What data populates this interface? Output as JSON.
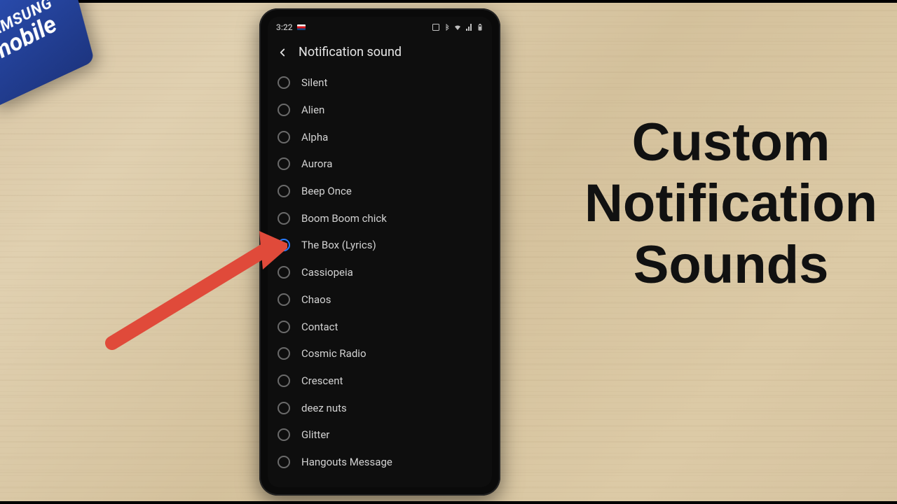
{
  "cube": {
    "line1": "SAMSUNG",
    "line2": "mobile"
  },
  "status": {
    "time": "3:22"
  },
  "header": {
    "title": "Notification sound"
  },
  "sounds": [
    {
      "label": "Silent",
      "selected": false
    },
    {
      "label": "Alien",
      "selected": false
    },
    {
      "label": "Alpha",
      "selected": false
    },
    {
      "label": "Aurora",
      "selected": false
    },
    {
      "label": "Beep Once",
      "selected": false
    },
    {
      "label": "Boom Boom chick",
      "selected": false
    },
    {
      "label": "The Box (Lyrics)",
      "selected": true
    },
    {
      "label": "Cassiopeia",
      "selected": false
    },
    {
      "label": "Chaos",
      "selected": false
    },
    {
      "label": "Contact",
      "selected": false
    },
    {
      "label": "Cosmic Radio",
      "selected": false
    },
    {
      "label": "Crescent",
      "selected": false
    },
    {
      "label": "deez nuts",
      "selected": false
    },
    {
      "label": "Glitter",
      "selected": false
    },
    {
      "label": "Hangouts Message",
      "selected": false
    }
  ],
  "caption": {
    "line1": "Custom",
    "line2": "Notification",
    "line3": "Sounds"
  },
  "colors": {
    "accent": "#2a7cff",
    "arrow": "#e04a3a"
  }
}
